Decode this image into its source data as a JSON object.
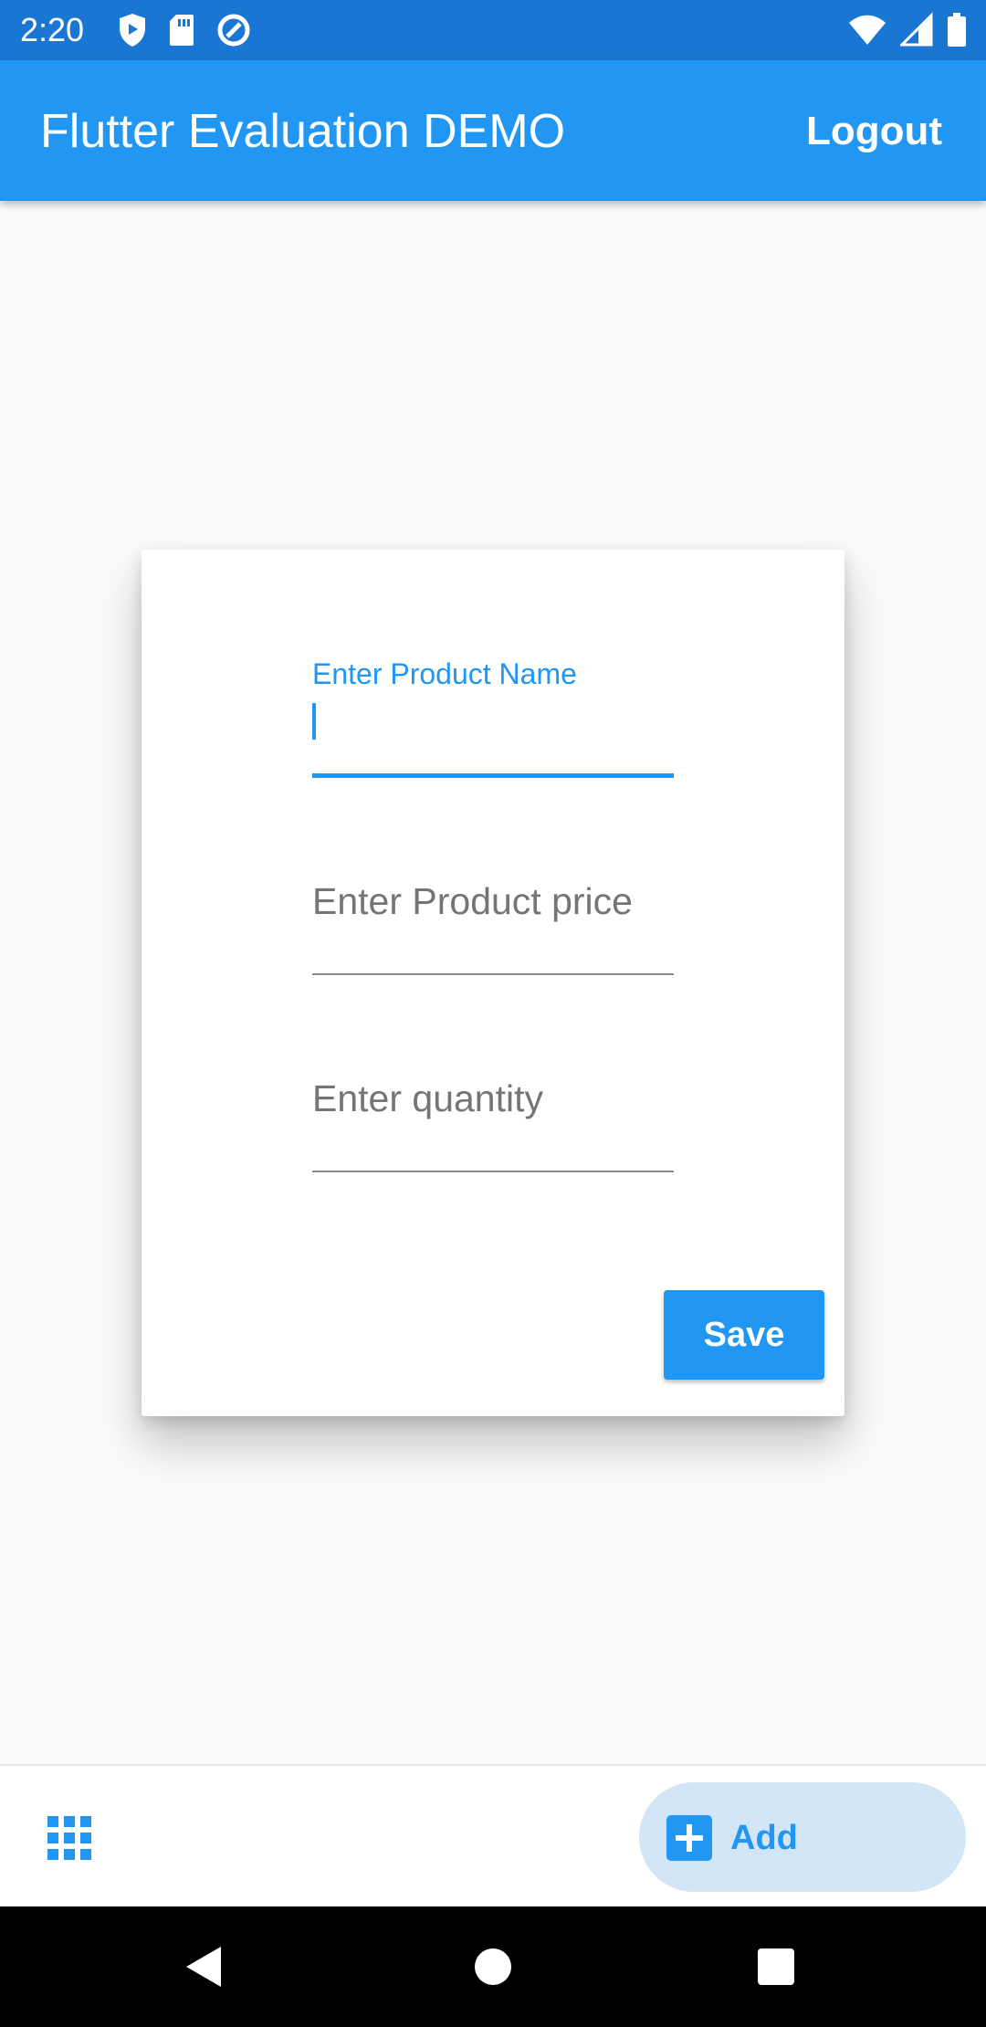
{
  "status_bar": {
    "time": "2:20",
    "left_icons": [
      "shield-icon",
      "sd-card-icon",
      "sync-icon"
    ],
    "right_icons": [
      "wifi-icon",
      "signal-icon",
      "battery-icon"
    ]
  },
  "app_bar": {
    "title": "Flutter Evaluation DEMO",
    "logout_label": "Logout"
  },
  "form": {
    "product_name": {
      "label": "Enter Product Name",
      "value": ""
    },
    "product_price": {
      "placeholder": "Enter Product price",
      "value": ""
    },
    "quantity": {
      "placeholder": "Enter quantity",
      "value": ""
    },
    "save_label": "Save"
  },
  "bottom_bar": {
    "grid_icon": "grid-apps-icon",
    "add_icon": "add-box-icon",
    "add_label": "Add"
  },
  "nav_bar": {
    "icons": [
      "back-icon",
      "home-icon",
      "recents-icon"
    ]
  },
  "colors": {
    "status_bar": "#1976d2",
    "primary": "#2196f3",
    "background": "#fafafa",
    "add_button_bg": "#d2e6f8",
    "placeholder_text": "#757575"
  }
}
